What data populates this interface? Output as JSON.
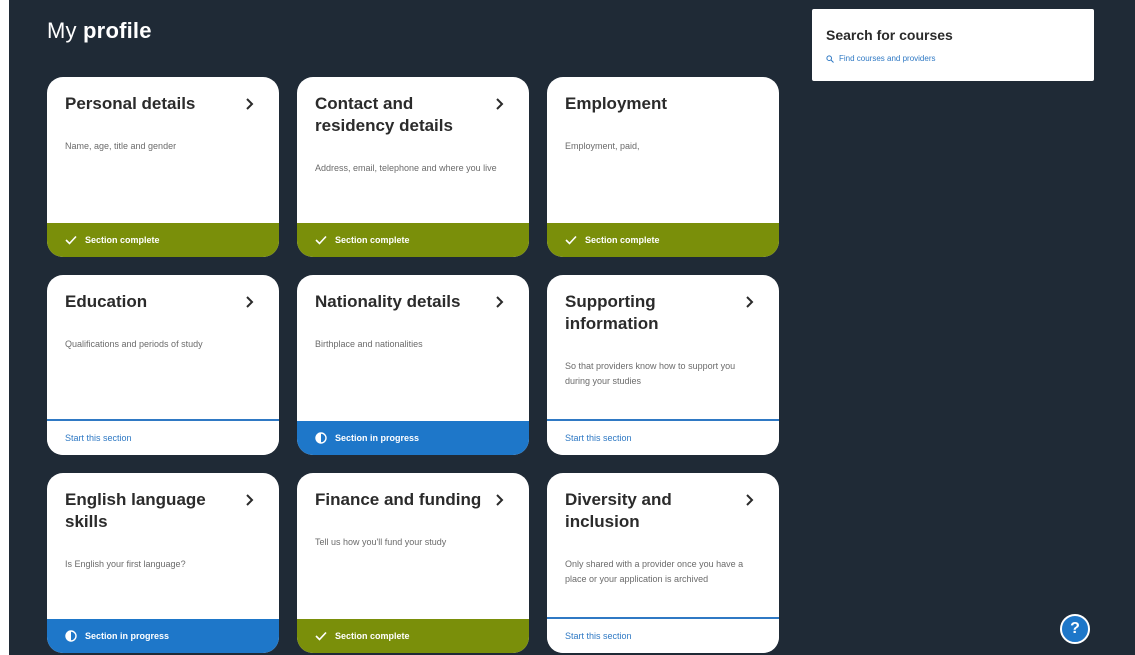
{
  "page": {
    "title_prefix": "My",
    "title_bold": "profile"
  },
  "search": {
    "title": "Search for courses",
    "link": "Find courses and providers",
    "link_icon": "search-icon"
  },
  "cards": [
    {
      "title": "Personal details",
      "description": "Name, age, title and gender",
      "status": "complete",
      "status_label": "Section complete"
    },
    {
      "title": "Contact and residency details",
      "description": "Address, email, telephone and where you live",
      "status": "complete",
      "status_label": "Section complete"
    },
    {
      "title": "Employment",
      "description": "Employment, paid,",
      "status": "complete",
      "status_label": "Section complete"
    },
    {
      "title": "Education",
      "description": "Qualifications and periods of study",
      "status": "not_started",
      "status_label": "Start this section"
    },
    {
      "title": "Nationality details",
      "description": "Birthplace and nationalities",
      "status": "in_progress",
      "status_label": "Section in progress"
    },
    {
      "title": "Supporting information",
      "description": "So that providers know how to support you during your studies",
      "status": "not_started",
      "status_label": "Start this section"
    },
    {
      "title": "English language skills",
      "description": "Is English your first language?",
      "status": "in_progress",
      "status_label": "Section in progress"
    },
    {
      "title": "Finance and funding",
      "description": "Tell us how you'll fund your study",
      "status": "complete",
      "status_label": "Section complete"
    },
    {
      "title": "Diversity and inclusion",
      "description": "Only shared with a provider once you have a place or your application is archived",
      "status": "not_started",
      "status_label": "Start this section"
    }
  ],
  "help": {
    "label": "?"
  },
  "colors": {
    "background": "#1f2a36",
    "complete": "#7a8f0a",
    "in_progress": "#1e77c9",
    "link": "#2f79c4"
  }
}
